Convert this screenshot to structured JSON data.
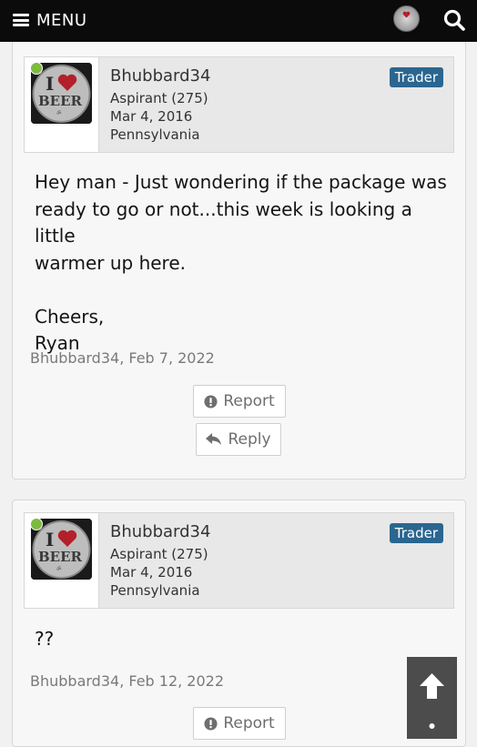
{
  "header": {
    "menu_label": "MENU",
    "icons": [
      "hamburger-icon",
      "avatar-icon",
      "search-icon"
    ]
  },
  "posts": [
    {
      "username": "Bhubbard34",
      "rank": "Aspirant (275)",
      "joined": "Mar 4, 2016",
      "location": "Pennsylvania",
      "badge": "Trader",
      "message_lines": [
        "Hey man - Just wondering if the package was",
        "ready to go or not...this week is looking a little",
        "warmer up here.",
        "",
        "Cheers,",
        "Ryan"
      ],
      "meta": "Bhubbard34, Feb 7, 2022",
      "report_label": "Report",
      "reply_label": "Reply"
    },
    {
      "username": "Bhubbard34",
      "rank": "Aspirant (275)",
      "joined": "Mar 4, 2016",
      "location": "Pennsylvania",
      "badge": "Trader",
      "message": "??",
      "meta": "Bhubbard34, Feb 12, 2022",
      "report_label": "Report"
    }
  ],
  "colors": {
    "topbar": "#0b0b0b",
    "badge": "#2b6690",
    "online": "#7dbb3f",
    "scroll_button": "#4c4c4c"
  }
}
